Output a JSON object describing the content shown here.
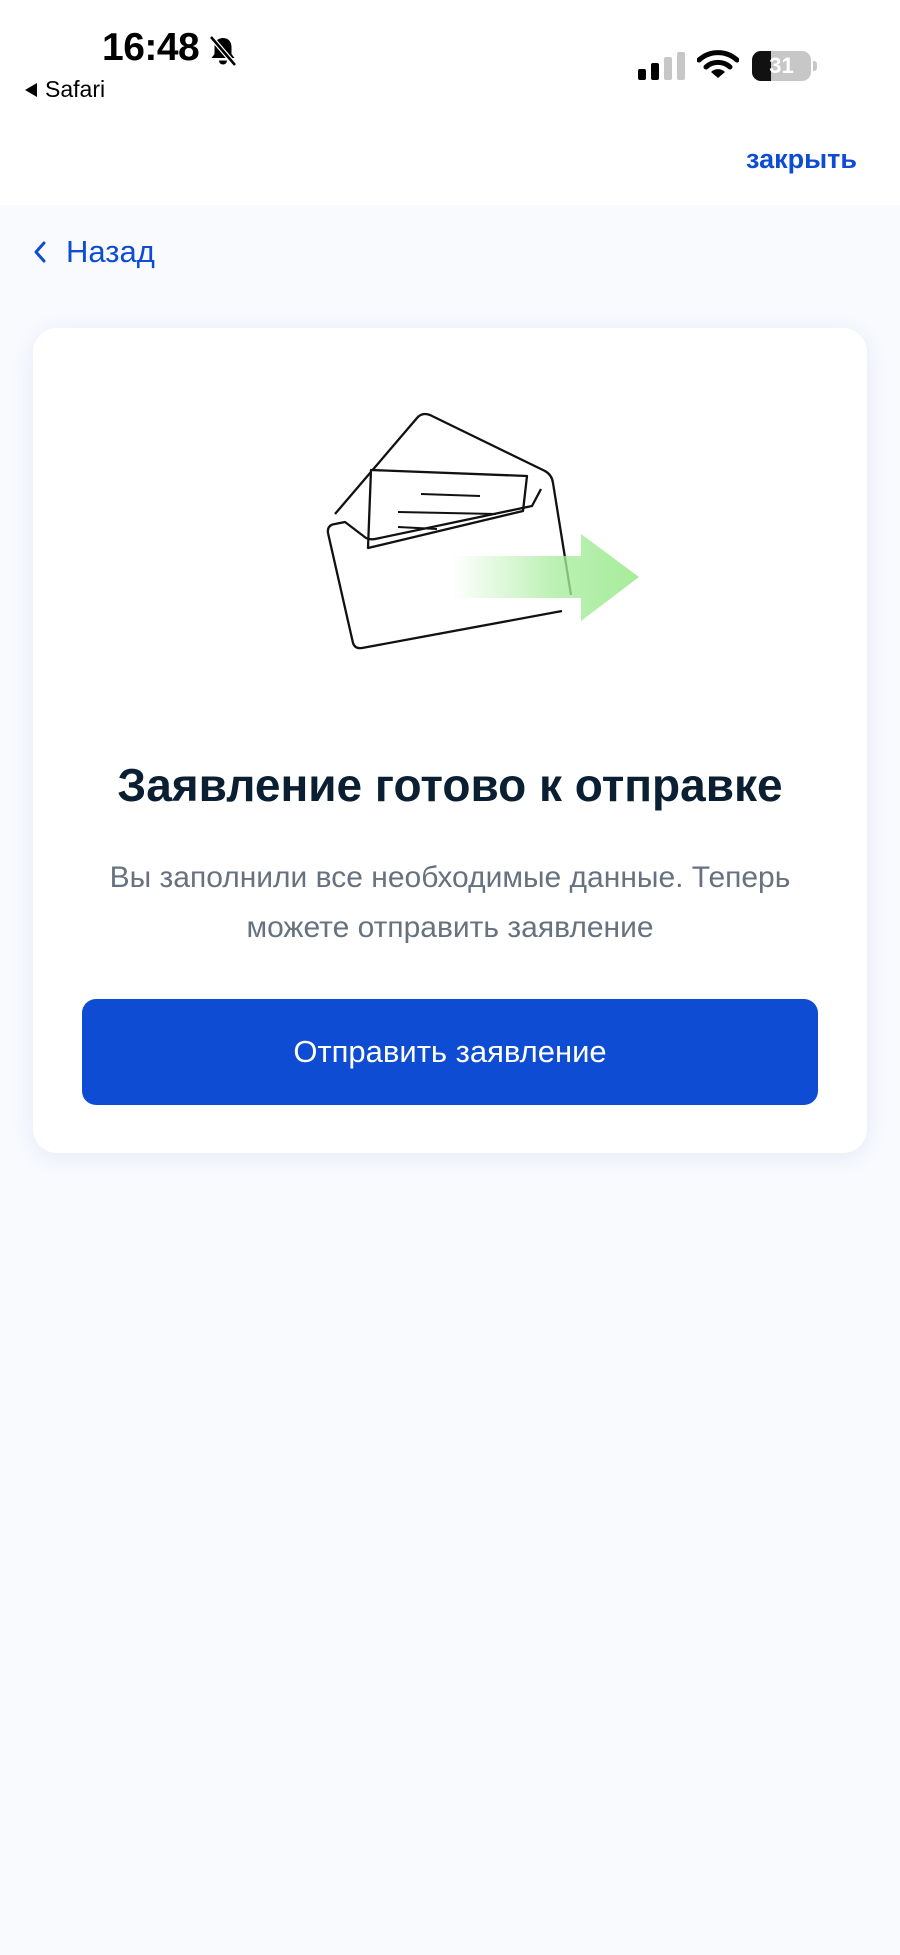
{
  "status_bar": {
    "time": "16:48",
    "back_app": "Safari",
    "battery": "31",
    "icons": [
      "bell-slash-icon",
      "signal-icon",
      "wifi-icon",
      "battery-icon"
    ]
  },
  "header": {
    "close_label": "закрыть"
  },
  "nav": {
    "back_label": "Назад"
  },
  "card": {
    "illustration": "envelope-send-icon",
    "title": "Заявление готово к отправке",
    "description": "Вы заполнили все необходимые данные. Теперь можете отправить заявление",
    "submit_label": "Отправить заявление"
  },
  "colors": {
    "accent": "#0d4cd3",
    "title": "#0b1f33",
    "text_secondary": "#66727f",
    "background": "#f8fafe",
    "arrow_green": "#a6ec9b"
  }
}
